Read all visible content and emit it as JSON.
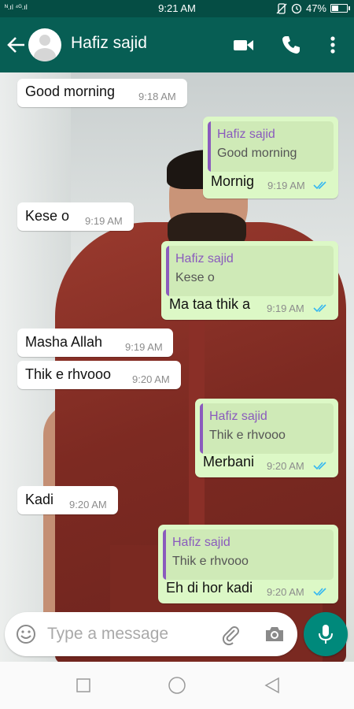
{
  "status_bar": {
    "signal": "ᴺ.ıl ⁴ᴳ.ıl",
    "time": "9:21 AM",
    "battery": "47%",
    "battery_level": 0.47
  },
  "header": {
    "contact_name": "Hafiz sajid",
    "icons": [
      "back-arrow-icon",
      "avatar",
      "video-call-icon",
      "phone-icon",
      "more-options-icon"
    ]
  },
  "messages": [
    {
      "direction": "in",
      "text": "Good morning",
      "time": "9:18 AM"
    },
    {
      "direction": "out",
      "quote_author": "Hafiz sajid",
      "quote_text": "Good morning",
      "text": "Mornig",
      "time": "9:19 AM",
      "read": true
    },
    {
      "direction": "in",
      "text": "Kese o",
      "time": "9:19 AM"
    },
    {
      "direction": "out",
      "quote_author": "Hafiz sajid",
      "quote_text": "Kese o",
      "text": "Ma taa thik a",
      "time": "9:19 AM",
      "read": true
    },
    {
      "direction": "in",
      "text": "Masha Allah",
      "time": "9:19 AM"
    },
    {
      "direction": "in",
      "text": "Thik e rhvooo",
      "time": "9:20 AM"
    },
    {
      "direction": "out",
      "quote_author": "Hafiz sajid",
      "quote_text": "Thik e rhvooo",
      "text": "Merbani",
      "time": "9:20 AM",
      "read": true
    },
    {
      "direction": "in",
      "text": "Kadi",
      "time": "9:20 AM"
    },
    {
      "direction": "out",
      "quote_author": "Hafiz sajid",
      "quote_text": "Thik e rhvooo",
      "text": "Eh di hor kadi",
      "time": "9:20 AM",
      "read": true
    }
  ],
  "composer": {
    "placeholder": "Type a message"
  },
  "colors": {
    "header": "#075e54",
    "outgoing_bubble": "#dcf8c6",
    "incoming_bubble": "#ffffff",
    "read_ticks": "#34b7f1",
    "quote_author": "#8a5bbd",
    "mic_button": "#00897b"
  }
}
